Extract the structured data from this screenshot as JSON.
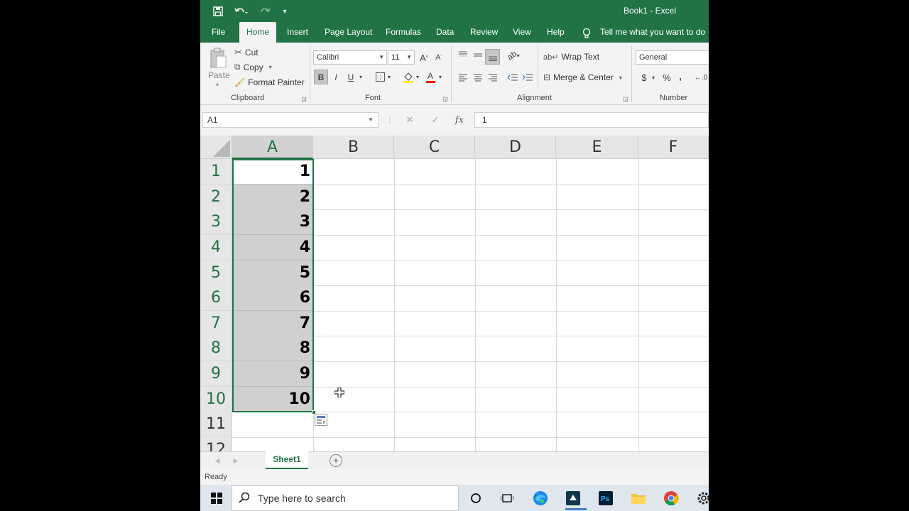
{
  "window": {
    "title": "Book1  -  Excel"
  },
  "ribbon_tabs": [
    "File",
    "Home",
    "Insert",
    "Page Layout",
    "Formulas",
    "Data",
    "Review",
    "View",
    "Help"
  ],
  "tell_me": "Tell me what you want to do",
  "clipboard": {
    "paste": "Paste",
    "cut": "Cut",
    "copy": "Copy",
    "format_painter": "Format Painter",
    "label": "Clipboard"
  },
  "font": {
    "name": "Calibri",
    "size": "11",
    "label": "Font",
    "bold": "B",
    "italic": "I",
    "underline": "U",
    "grow": "A",
    "color_letter": "A"
  },
  "alignment": {
    "wrap_text": "Wrap Text",
    "merge_center": "Merge & Center",
    "label": "Alignment"
  },
  "number": {
    "format": "General",
    "label": "Number",
    "currency": "$",
    "percent": "%",
    "comma": ","
  },
  "formula_bar": {
    "name_box": "A1",
    "formula": "1",
    "fx": "fx",
    "cancel": "✕",
    "enter": "✓"
  },
  "columns": [
    "A",
    "B",
    "C",
    "D",
    "E",
    "F"
  ],
  "rows": [
    "1",
    "2",
    "3",
    "4",
    "5",
    "6",
    "7",
    "8",
    "9",
    "10",
    "11",
    "12"
  ],
  "cells_a": [
    "1",
    "2",
    "3",
    "4",
    "5",
    "6",
    "7",
    "8",
    "9",
    "10"
  ],
  "sheet": {
    "name": "Sheet1",
    "add": "+"
  },
  "status": "Ready",
  "taskbar": {
    "search_placeholder": "Type here to search"
  },
  "colors": {
    "accent": "#217346",
    "selection": "#d0d0d0"
  }
}
